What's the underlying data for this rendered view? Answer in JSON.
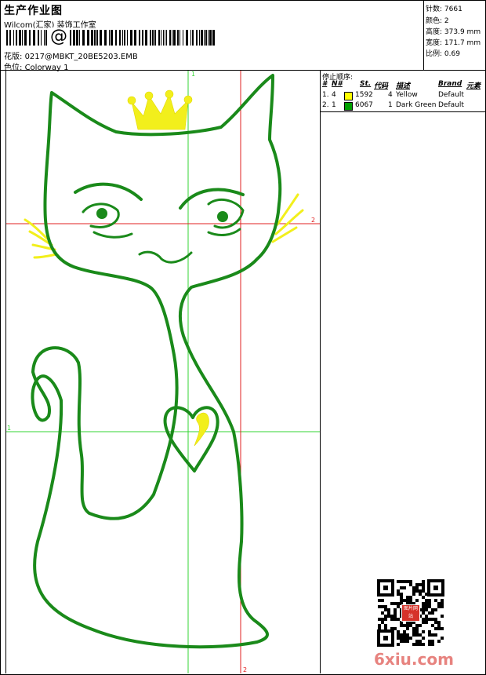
{
  "header": {
    "title": "生产作业图",
    "company": "Wilcom(汇家) 装饰工作室",
    "at_mark": "@",
    "design_label": "花版:",
    "design_value": "0217@MBKT_20BE5203.EMB",
    "colorway_label": "色位:",
    "colorway_value": "Colorway 1"
  },
  "stats": [
    {
      "label": "针数:",
      "value": "7661"
    },
    {
      "label": "颜色:",
      "value": "2"
    },
    {
      "label": "高度:",
      "value": "373.9 mm"
    },
    {
      "label": "宽度:",
      "value": "171.7 mm"
    },
    {
      "label": "比例:",
      "value": "0.69"
    }
  ],
  "canvas": {
    "guide_labels": {
      "green_top": "1",
      "green_left": "1",
      "red_right": "2",
      "red_bottom": "2"
    },
    "colors": {
      "stitch_green": "#1a8a1a",
      "stitch_yellow": "#f2ef1c",
      "guide_green": "#33d633",
      "guide_red": "#e02020"
    }
  },
  "stop_sequence": {
    "title": "停止顺序:",
    "headers": {
      "num": "#",
      "n": "N#",
      "st": "St.",
      "code": "代码",
      "desc": "描述",
      "brand": "Brand",
      "element": "元素"
    },
    "rows": [
      {
        "num": "1.",
        "n": "4",
        "swatch": "#ffff00",
        "st": "1592",
        "code": "4",
        "desc": "Yellow",
        "brand": "Default"
      },
      {
        "num": "2.",
        "n": "1",
        "swatch": "#00a000",
        "st": "6067",
        "code": "1",
        "desc": "Dark Green",
        "brand": "Default"
      }
    ]
  },
  "watermark": {
    "text": "6xiu.com",
    "stamp_text": "图片网站",
    "color": "#e7837f"
  }
}
